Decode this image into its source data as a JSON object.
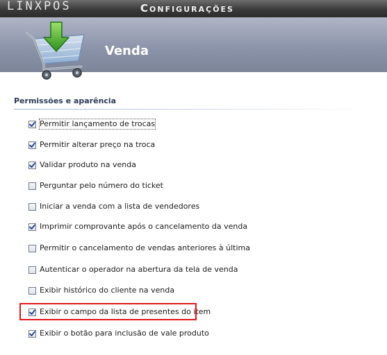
{
  "app": {
    "brand": "LINXPOS",
    "title": "Configurações"
  },
  "page": {
    "title": "Venda",
    "icon": "shopping-cart-download-icon"
  },
  "section": {
    "title": "Permissões e aparência"
  },
  "options": [
    {
      "label": "Permitir lançamento de trocas",
      "checked": true
    },
    {
      "label": "Permitir alterar preço na troca",
      "checked": true
    },
    {
      "label": "Validar produto na venda",
      "checked": true
    },
    {
      "label": "Perguntar pelo número do ticket",
      "checked": false
    },
    {
      "label": "Iniciar a venda com a lista de vendedores",
      "checked": false
    },
    {
      "label": "Imprimir comprovante após o cancelamento da venda",
      "checked": true
    },
    {
      "label": "Permitir o cancelamento de vendas anteriores à última",
      "checked": false
    },
    {
      "label": "Autenticar o operador na abertura da tela de venda",
      "checked": false
    },
    {
      "label": "Exibir histórico do cliente na venda",
      "checked": false
    },
    {
      "label": "Exibir o campo da lista de presentes do item",
      "checked": true
    },
    {
      "label": "Exibir o botão para inclusão de vale produto",
      "checked": true
    }
  ],
  "colors": {
    "highlight": "#e0161b",
    "header": "#8a92a8",
    "topbar": "#3a3a3a"
  }
}
